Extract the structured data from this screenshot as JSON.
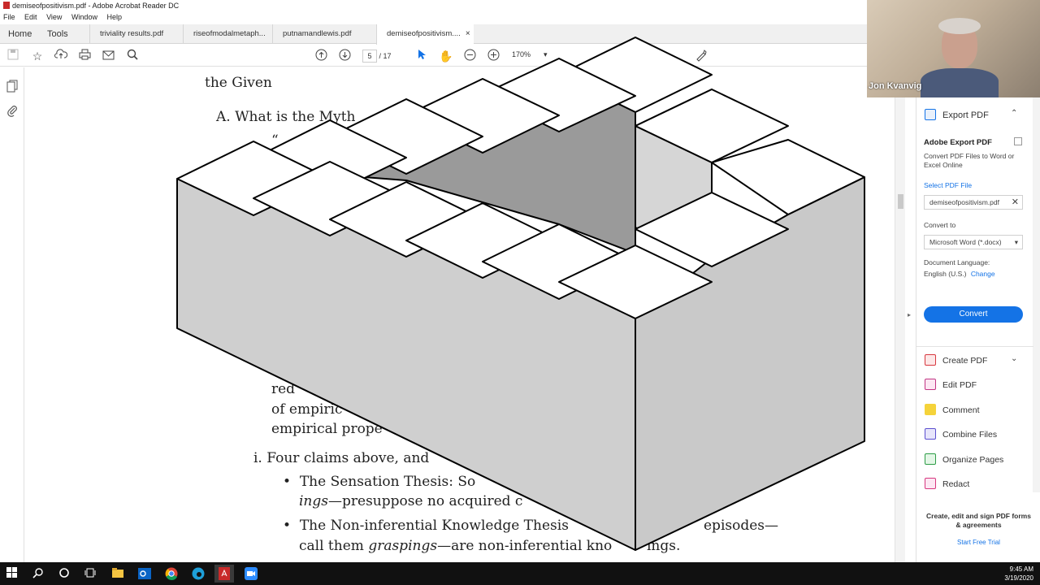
{
  "window": {
    "title": "demiseofpositivism.pdf - Adobe Acrobat Reader DC"
  },
  "menu": [
    "File",
    "Edit",
    "View",
    "Window",
    "Help"
  ],
  "tabs": {
    "home": "Home",
    "tools": "Tools",
    "docs": [
      "triviality results.pdf",
      "riseofmodalmetaph...",
      "putnamandlewis.pdf",
      "demiseofpositivism...."
    ],
    "close": "×"
  },
  "toolbar": {
    "page_current": "5",
    "page_sep": "/",
    "page_total": "17",
    "zoom": "170%"
  },
  "document": {
    "lines": {
      "given": "the Given",
      "heading_a": "A.  What is the Myth",
      "quote_mark": "“",
      "red": "red",
      "of_empiric": "of empiric",
      "empirical_prop": "empirical prope",
      "four_claims": "i.  Four claims above, and",
      "sensation": "The  Sensation  Thesis:  So",
      "ings": "ings",
      "presuppose": "—presuppose no acquired c",
      "noninf": "The Non-inferential Knowledge Thesis",
      "episodes": "episodes—",
      "call_them": "call them ",
      "graspings": "graspings",
      "are_noninf": "—are non-inferential kno",
      "ings_end": "ings."
    }
  },
  "webcam": {
    "name": "Jon Kvanvig"
  },
  "right_panel": {
    "export_title": "Export PDF",
    "adobe_export": "Adobe Export PDF",
    "convert_desc": "Convert PDF Files to Word or Excel Online",
    "select_file": "Select PDF File",
    "file_name": "demiseofpositivism.pdf",
    "convert_to": "Convert to",
    "format": "Microsoft Word (*.docx)",
    "doc_language": "Document Language:",
    "language": "English (U.S.)",
    "change": "Change",
    "convert_btn": "Convert",
    "tools": [
      "Create PDF",
      "Edit PDF",
      "Comment",
      "Combine Files",
      "Organize Pages",
      "Redact"
    ],
    "promo_text": "Create, edit and sign PDF forms & agreements",
    "promo_link": "Start Free Trial"
  },
  "clock": {
    "time": "9:45 AM",
    "date": "3/19/2020"
  },
  "colors": {
    "accent": "#1473e6",
    "illusion_top": "#ffffff",
    "illusion_side": "#cccccc",
    "illusion_shadow": "#999999"
  }
}
